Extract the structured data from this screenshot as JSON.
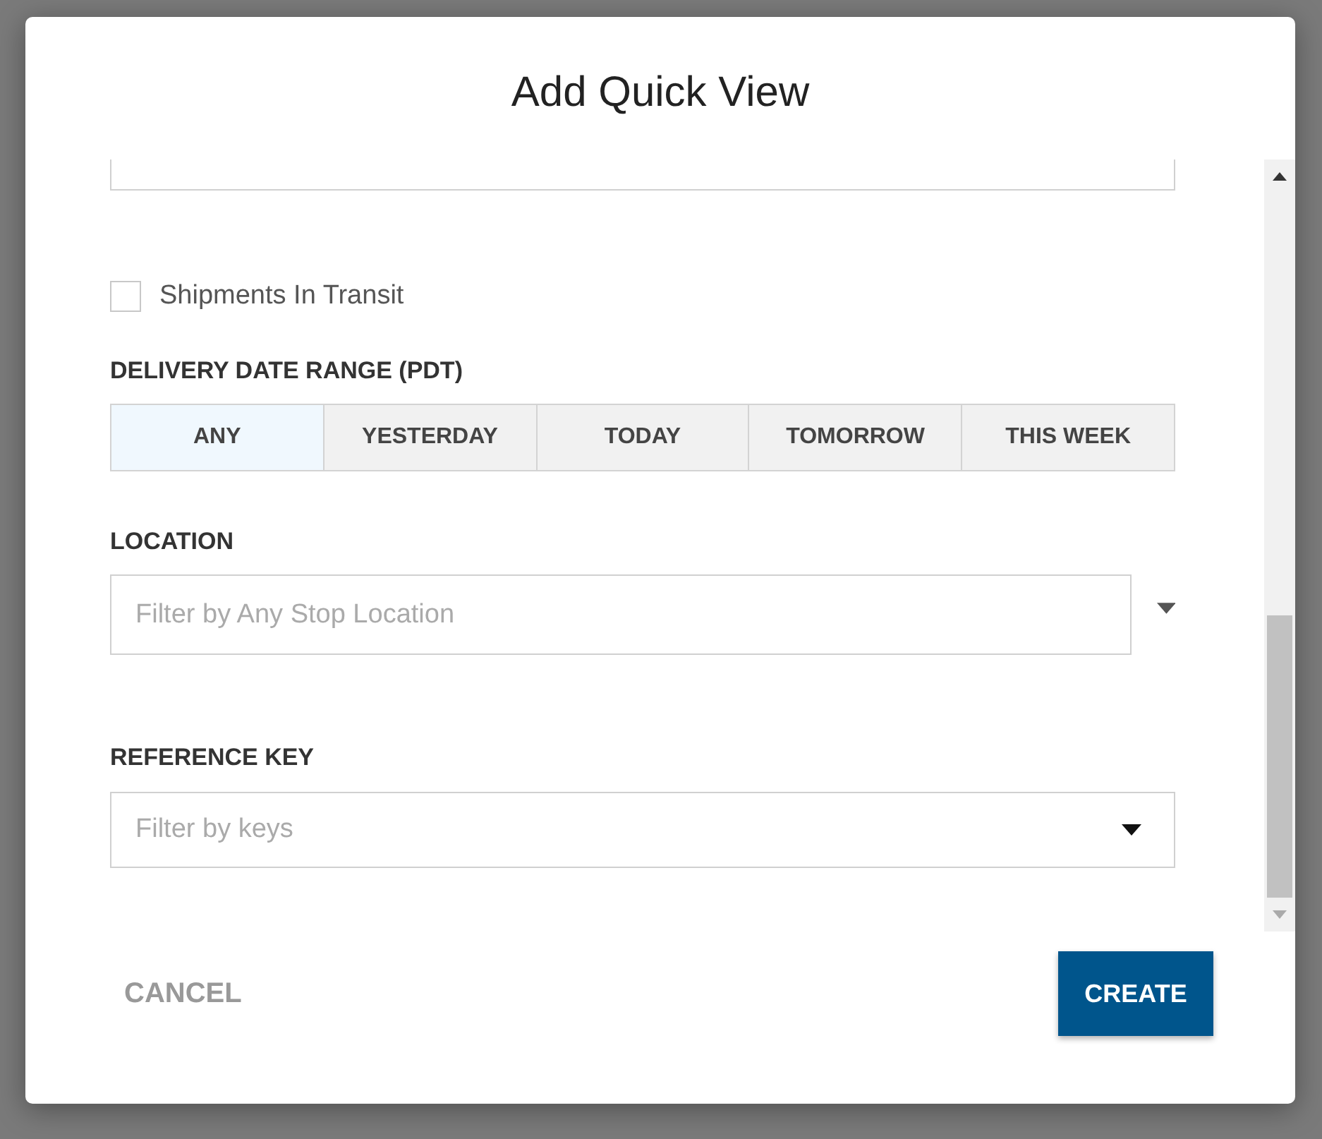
{
  "dialog": {
    "title": "Add Quick View"
  },
  "shipments_in_transit": {
    "label": "Shipments In Transit",
    "checked": false
  },
  "delivery_date_range": {
    "label": "DELIVERY DATE RANGE (PDT)",
    "options": [
      {
        "label": "ANY",
        "selected": true
      },
      {
        "label": "YESTERDAY",
        "selected": false
      },
      {
        "label": "TODAY",
        "selected": false
      },
      {
        "label": "TOMORROW",
        "selected": false
      },
      {
        "label": "THIS WEEK",
        "selected": false
      }
    ]
  },
  "location": {
    "label": "LOCATION",
    "placeholder": "Filter by Any Stop Location"
  },
  "reference_key": {
    "label": "REFERENCE KEY",
    "placeholder": "Filter by keys"
  },
  "buttons": {
    "cancel": "CANCEL",
    "create": "CREATE"
  }
}
